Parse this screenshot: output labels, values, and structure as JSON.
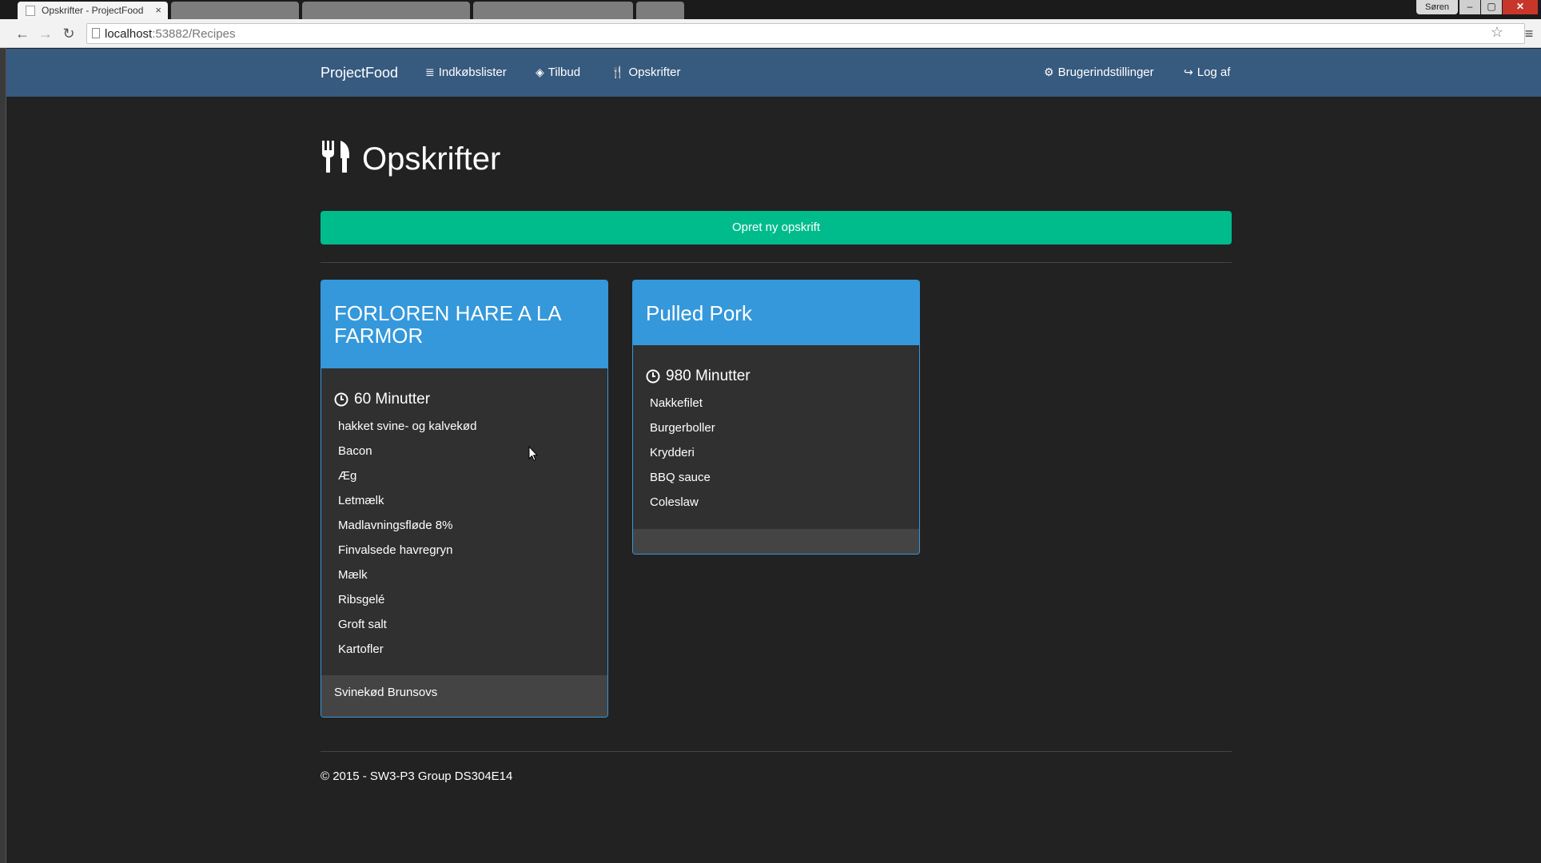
{
  "browser": {
    "active_tab": {
      "title": "Opskrifter - ProjectFood",
      "close": "×"
    },
    "user_chip": "Søren",
    "window_controls": {
      "minimize": "–",
      "maximize": "▢",
      "close": "✕"
    },
    "nav": {
      "back": "←",
      "forward": "→",
      "reload": "↻"
    },
    "address": {
      "host": "localhost",
      "path": ":53882/Recipes"
    },
    "star": "☆",
    "menu": "≡"
  },
  "navbar": {
    "brand": "ProjectFood",
    "links": [
      {
        "label": "Indkøbslister",
        "icon": "≣"
      },
      {
        "label": "Tilbud",
        "icon": "◈"
      },
      {
        "label": "Opskrifter",
        "icon": "🍴"
      }
    ],
    "right": [
      {
        "label": "Brugerindstillinger",
        "icon": "⚙"
      },
      {
        "label": "Log af",
        "icon": "↪"
      }
    ]
  },
  "page": {
    "title": "Opskrifter",
    "create_button": "Opret ny opskrift"
  },
  "recipes": [
    {
      "name": "FORLOREN HARE A LA FARMOR",
      "duration": "60 Minutter",
      "ingredients": [
        "hakket svine- og kalvekød",
        "Bacon",
        "Æg",
        "Letmælk",
        "Madlavningsfløde 8%",
        "Finvalsede havregryn",
        "Mælk",
        "Ribsgelé",
        "Groft salt",
        "Kartofler"
      ],
      "footer": "Svinekød Brunsovs"
    },
    {
      "name": "Pulled Pork",
      "duration": "980 Minutter",
      "ingredients": [
        "Nakkefilet",
        "Burgerboller",
        "Krydderi",
        "BBQ sauce",
        "Coleslaw"
      ],
      "footer": ""
    }
  ],
  "footer": {
    "text": "© 2015 - SW3-P3 Group DS304E14"
  },
  "colors": {
    "background": "#222222",
    "navbar": "#375a7f",
    "primary": "#3498db",
    "success": "#00bc8c",
    "card_body": "#303030",
    "card_footer": "#444444"
  }
}
